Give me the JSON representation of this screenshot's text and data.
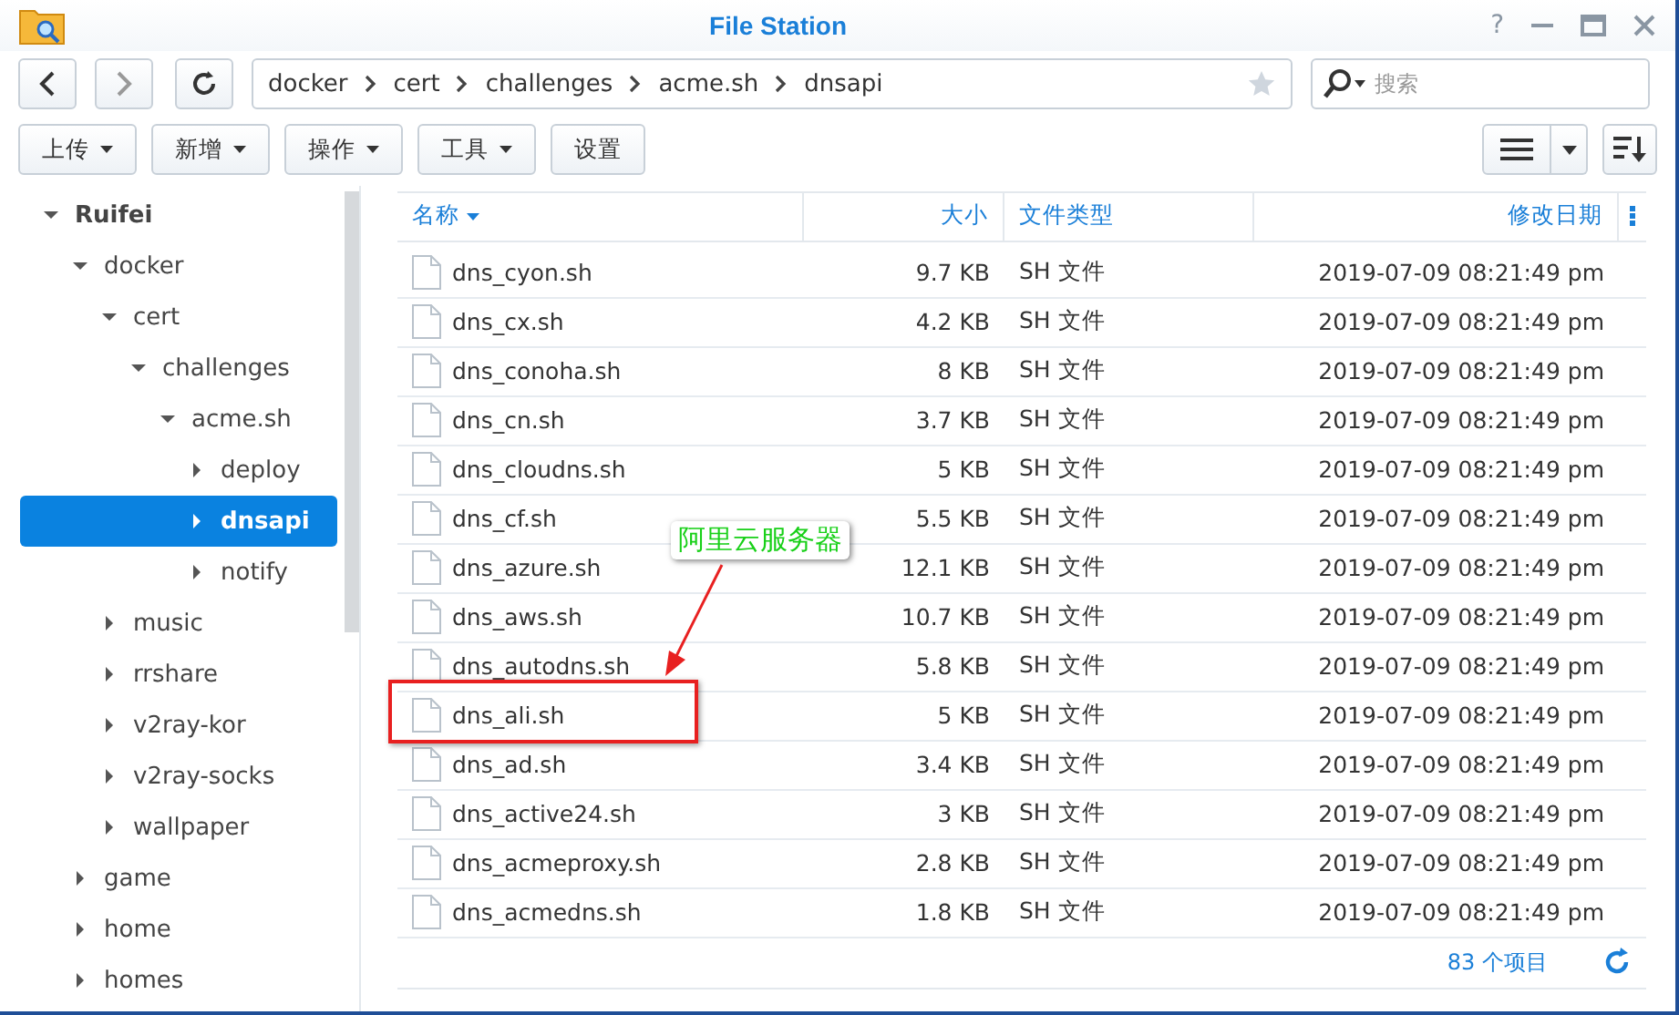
{
  "window": {
    "title": "File Station",
    "help": "?"
  },
  "path": {
    "segments": [
      "docker",
      "cert",
      "challenges",
      "acme.sh",
      "dnsapi"
    ],
    "favorite": false
  },
  "search": {
    "placeholder": "搜索"
  },
  "toolbar": {
    "buttons": [
      {
        "label": "上传",
        "dropdown": true
      },
      {
        "label": "新增",
        "dropdown": true
      },
      {
        "label": "操作",
        "dropdown": true
      },
      {
        "label": "工具",
        "dropdown": true
      },
      {
        "label": "设置",
        "dropdown": false
      }
    ]
  },
  "tree": [
    {
      "label": "Ruifei",
      "expanded": true,
      "selected": false,
      "children": [
        {
          "label": "docker",
          "expanded": true,
          "selected": false,
          "children": [
            {
              "label": "cert",
              "expanded": true,
              "selected": false,
              "children": [
                {
                  "label": "challenges",
                  "expanded": true,
                  "selected": false,
                  "children": [
                    {
                      "label": "acme.sh",
                      "expanded": true,
                      "selected": false,
                      "children": [
                        {
                          "label": "deploy",
                          "expanded": false,
                          "selected": false
                        },
                        {
                          "label": "dnsapi",
                          "expanded": false,
                          "selected": true
                        },
                        {
                          "label": "notify",
                          "expanded": false,
                          "selected": false
                        }
                      ]
                    }
                  ]
                }
              ]
            },
            {
              "label": "music",
              "expanded": false,
              "selected": false
            },
            {
              "label": "rrshare",
              "expanded": false,
              "selected": false
            },
            {
              "label": "v2ray-kor",
              "expanded": false,
              "selected": false
            },
            {
              "label": "v2ray-socks",
              "expanded": false,
              "selected": false
            },
            {
              "label": "wallpaper",
              "expanded": false,
              "selected": false
            }
          ]
        },
        {
          "label": "game",
          "expanded": false,
          "selected": false
        },
        {
          "label": "home",
          "expanded": false,
          "selected": false
        },
        {
          "label": "homes",
          "expanded": false,
          "selected": false
        }
      ]
    }
  ],
  "table": {
    "columns": [
      {
        "label": "名称",
        "sorted": true
      },
      {
        "label": "大小",
        "sorted": false
      },
      {
        "label": "文件类型",
        "sorted": false
      },
      {
        "label": "修改日期",
        "sorted": false
      }
    ],
    "rows": [
      [
        "dns_cyon.sh",
        "9.7 KB",
        "SH 文件",
        "2019-07-09 08:21:49 pm"
      ],
      [
        "dns_cx.sh",
        "4.2 KB",
        "SH 文件",
        "2019-07-09 08:21:49 pm"
      ],
      [
        "dns_conoha.sh",
        "8 KB",
        "SH 文件",
        "2019-07-09 08:21:49 pm"
      ],
      [
        "dns_cn.sh",
        "3.7 KB",
        "SH 文件",
        "2019-07-09 08:21:49 pm"
      ],
      [
        "dns_cloudns.sh",
        "5 KB",
        "SH 文件",
        "2019-07-09 08:21:49 pm"
      ],
      [
        "dns_cf.sh",
        "5.5 KB",
        "SH 文件",
        "2019-07-09 08:21:49 pm"
      ],
      [
        "dns_azure.sh",
        "12.1 KB",
        "SH 文件",
        "2019-07-09 08:21:49 pm"
      ],
      [
        "dns_aws.sh",
        "10.7 KB",
        "SH 文件",
        "2019-07-09 08:21:49 pm"
      ],
      [
        "dns_autodns.sh",
        "5.8 KB",
        "SH 文件",
        "2019-07-09 08:21:49 pm"
      ],
      [
        "dns_ali.sh",
        "5 KB",
        "SH 文件",
        "2019-07-09 08:21:49 pm"
      ],
      [
        "dns_ad.sh",
        "3.4 KB",
        "SH 文件",
        "2019-07-09 08:21:49 pm"
      ],
      [
        "dns_active24.sh",
        "3 KB",
        "SH 文件",
        "2019-07-09 08:21:49 pm"
      ],
      [
        "dns_acmeproxy.sh",
        "2.8 KB",
        "SH 文件",
        "2019-07-09 08:21:49 pm"
      ],
      [
        "dns_acmedns.sh",
        "1.8 KB",
        "SH 文件",
        "2019-07-09 08:21:49 pm"
      ]
    ]
  },
  "status_bar": {
    "count": "83 个项目"
  },
  "annotation": {
    "text": "阿里云服务器"
  }
}
